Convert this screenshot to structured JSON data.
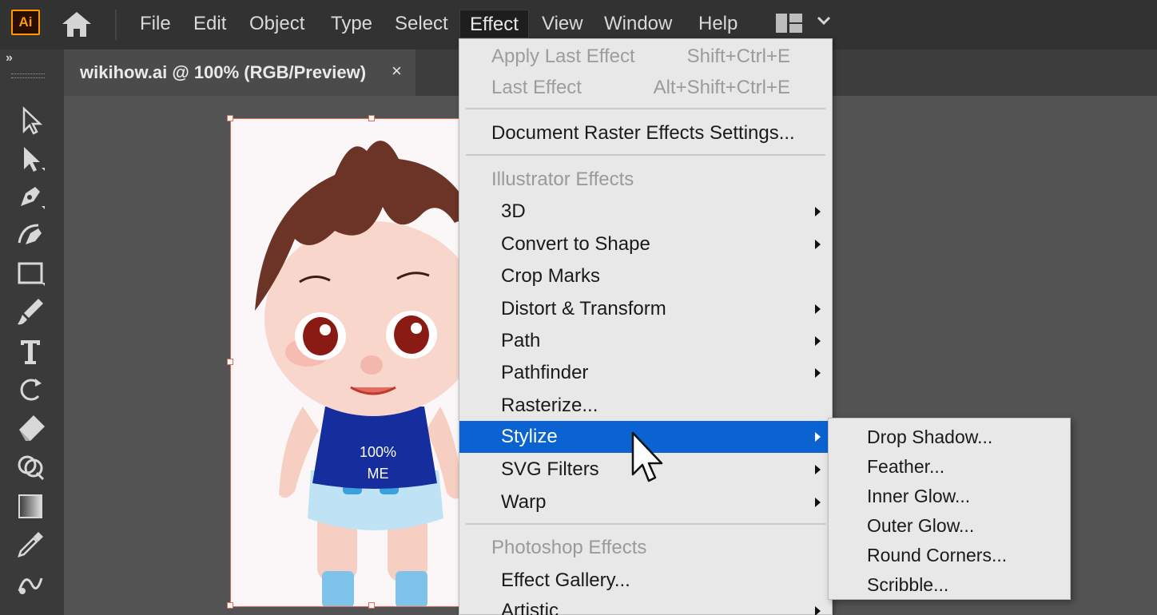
{
  "app": {
    "logo_text": "Ai"
  },
  "menubar": {
    "items": [
      "File",
      "Edit",
      "Object",
      "Type",
      "Select",
      "Effect",
      "View",
      "Window",
      "Help"
    ],
    "active": "Effect"
  },
  "toolbar": {
    "collapse_glyph": "»"
  },
  "document": {
    "tab_title": "wikihow.ai @ 100% (RGB/Preview)",
    "close_glyph": "×"
  },
  "artwork": {
    "shirt_line1": "100%",
    "shirt_line2": "ME"
  },
  "effect_menu": {
    "apply_last_effect": {
      "label": "Apply Last Effect",
      "shortcut": "Shift+Ctrl+E"
    },
    "last_effect": {
      "label": "Last Effect",
      "shortcut": "Alt+Shift+Ctrl+E"
    },
    "document_raster": "Document Raster Effects Settings...",
    "illustrator_header": "Illustrator Effects",
    "illustrator_items": [
      "3D",
      "Convert to Shape",
      "Crop Marks",
      "Distort & Transform",
      "Path",
      "Pathfinder",
      "Rasterize...",
      "Stylize",
      "SVG Filters",
      "Warp"
    ],
    "photoshop_header": "Photoshop Effects",
    "photoshop_items": [
      "Effect Gallery...",
      "Artistic"
    ],
    "highlighted": "Stylize"
  },
  "stylize_submenu": {
    "items": [
      "Drop Shadow...",
      "Feather...",
      "Inner Glow...",
      "Outer Glow...",
      "Round Corners...",
      "Scribble..."
    ]
  },
  "icons": {
    "home": "home-icon",
    "workspace": "workspace-switcher-icon",
    "tools": [
      "selection-tool-icon",
      "direct-selection-tool-icon",
      "pen-tool-icon",
      "curvature-tool-icon",
      "rectangle-tool-icon",
      "paintbrush-tool-icon",
      "type-tool-icon",
      "rotate-tool-icon",
      "eraser-tool-icon",
      "shape-builder-tool-icon",
      "gradient-tool-icon",
      "eyedropper-tool-icon",
      "blend-tool-icon"
    ]
  },
  "colors": {
    "menu_highlight": "#0a63d1",
    "logo_orange": "#ff9a00",
    "artboard_border": "#e46b4f"
  }
}
